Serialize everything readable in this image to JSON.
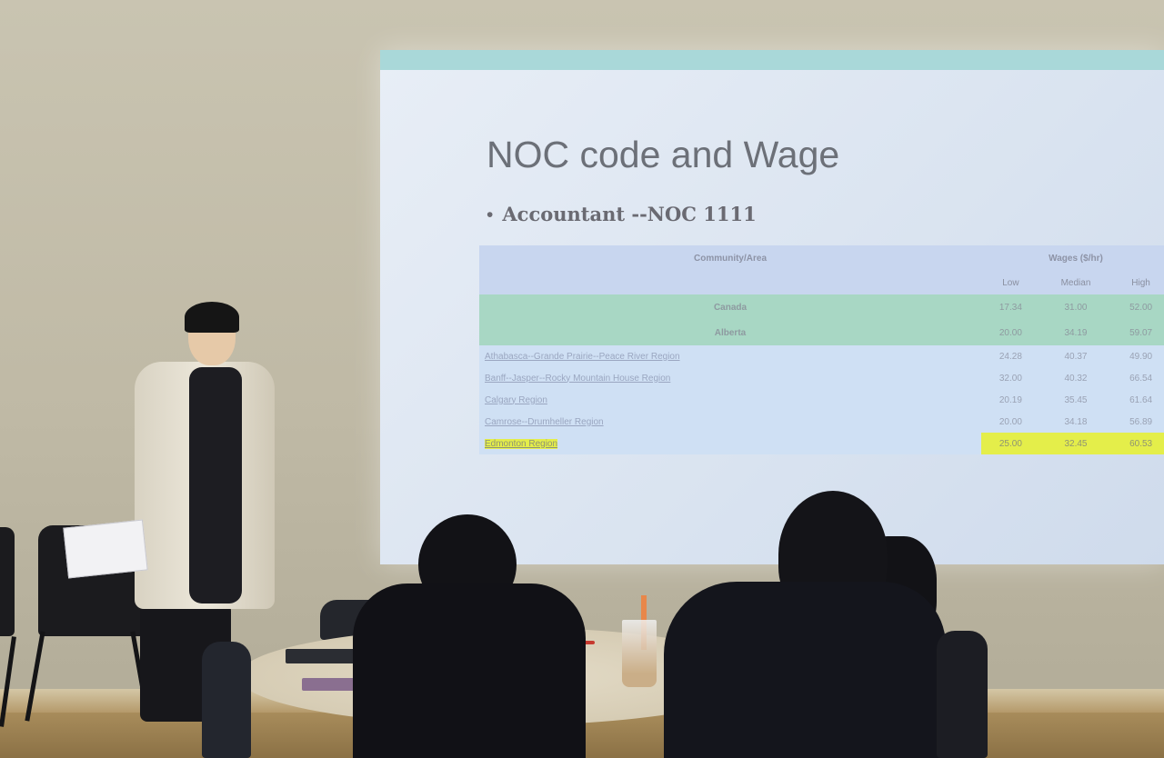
{
  "slide": {
    "title": "NOC code and Wage",
    "bullet": "Accountant --NOC 1111",
    "table": {
      "community_header": "Community/Area",
      "wages_header": "Wages ($/hr)",
      "sub_headers": [
        "Low",
        "Median",
        "High"
      ],
      "rows": [
        {
          "name": "Canada",
          "low": "17.34",
          "median": "31.00",
          "high": "52.00",
          "style": "green"
        },
        {
          "name": "Alberta",
          "low": "20.00",
          "median": "34.19",
          "high": "59.07",
          "style": "green"
        },
        {
          "name": "Athabasca--Grande Prairie--Peace River Region",
          "low": "24.28",
          "median": "40.37",
          "high": "49.90",
          "style": "region"
        },
        {
          "name": "Banff--Jasper--Rocky Mountain House Region",
          "low": "32.00",
          "median": "40.32",
          "high": "66.54",
          "style": "region"
        },
        {
          "name": "Calgary Region",
          "low": "20.19",
          "median": "35.45",
          "high": "61.64",
          "style": "region"
        },
        {
          "name": "Camrose--Drumheller Region",
          "low": "20.00",
          "median": "34.18",
          "high": "56.89",
          "style": "region"
        },
        {
          "name": "Edmonton Region",
          "low": "25.00",
          "median": "32.45",
          "high": "60.53",
          "style": "highlight"
        }
      ]
    }
  }
}
